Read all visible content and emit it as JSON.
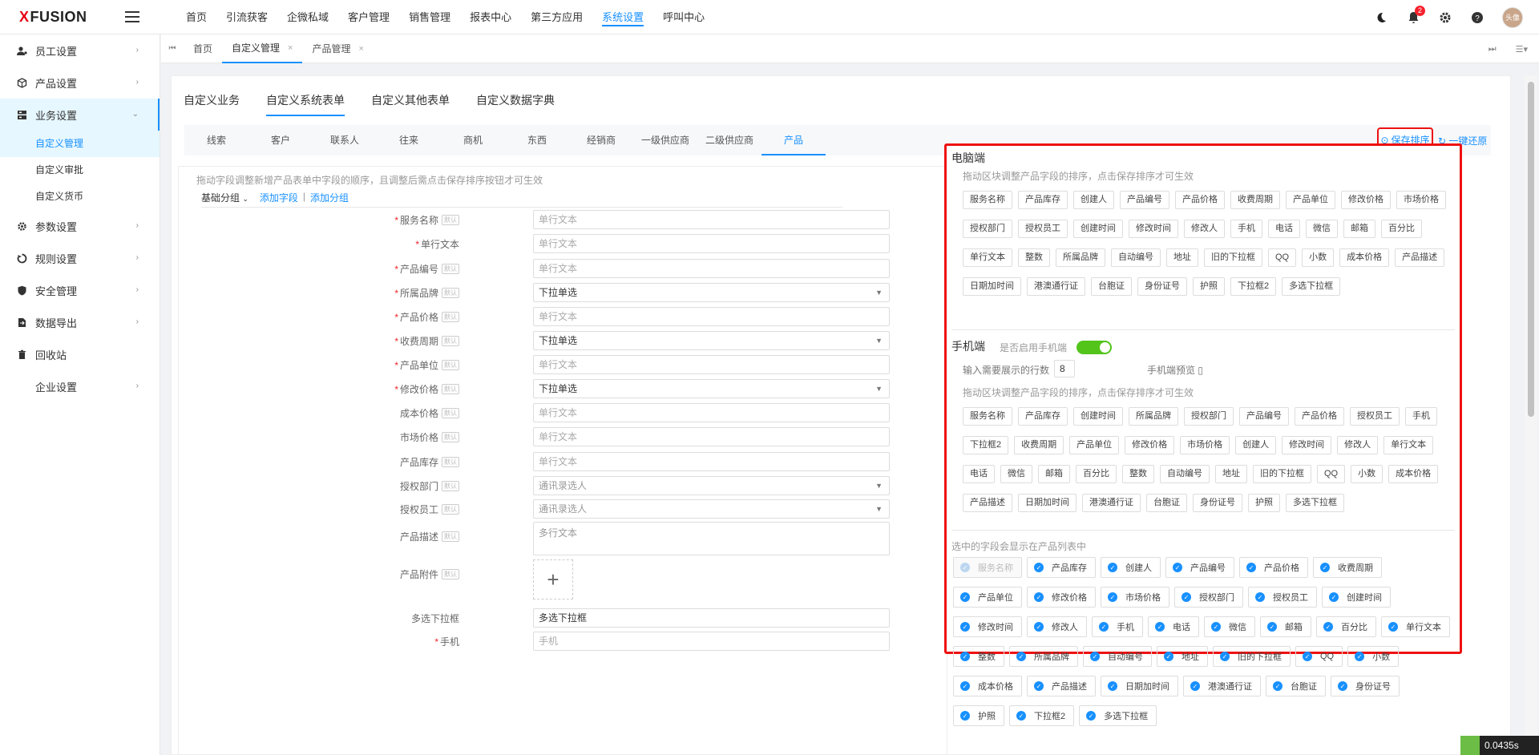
{
  "brand": {
    "prefix": "X",
    "name": "FUSION"
  },
  "topnav": [
    "首页",
    "引流获客",
    "企微私域",
    "客户管理",
    "销售管理",
    "报表中心",
    "第三方应用",
    "系统设置",
    "呼叫中心"
  ],
  "topnav_active": 7,
  "notif_count": "2",
  "avatar_text": "头像",
  "sidebar": [
    {
      "label": "员工设置",
      "icon": "user-gear-icon"
    },
    {
      "label": "产品设置",
      "icon": "box-icon"
    },
    {
      "label": "业务设置",
      "icon": "business-icon",
      "open": true,
      "children": [
        "自定义管理",
        "自定义审批",
        "自定义货币"
      ]
    },
    {
      "label": "参数设置",
      "icon": "settings-icon"
    },
    {
      "label": "规则设置",
      "icon": "rule-icon"
    },
    {
      "label": "安全管理",
      "icon": "shield-icon"
    },
    {
      "label": "数据导出",
      "icon": "export-icon"
    },
    {
      "label": "回收站",
      "icon": "trash-icon"
    },
    {
      "label": "企业设置",
      "icon": ""
    }
  ],
  "tabs": [
    "首页",
    "自定义管理",
    "产品管理"
  ],
  "tab_active": 1,
  "main_tabs": [
    "自定义业务",
    "自定义系统表单",
    "自定义其他表单",
    "自定义数据字典"
  ],
  "main_tab_active": 1,
  "sub_tabs": [
    "线索",
    "客户",
    "联系人",
    "往来",
    "商机",
    "东西",
    "经销商",
    "一级供应商",
    "二级供应商",
    "产品"
  ],
  "sub_tab_active": 9,
  "buttons": {
    "save": "保存排序",
    "restore": "一键还原"
  },
  "form": {
    "hint": "拖动字段调整新增产品表单中字段的顺序，且调整后需点击保存排序按钮才可生效",
    "group_select": "基础分组",
    "add_field": "添加字段",
    "add_group": "添加分组",
    "fields": [
      {
        "label": "服务名称",
        "req": true,
        "tag": "默认",
        "type": "text",
        "ph": "单行文本"
      },
      {
        "label": "单行文本",
        "req": true,
        "tag": "",
        "type": "text",
        "ph": "单行文本"
      },
      {
        "label": "产品编号",
        "req": true,
        "tag": "默认",
        "type": "text",
        "ph": "单行文本"
      },
      {
        "label": "所属品牌",
        "req": true,
        "tag": "默认",
        "type": "select",
        "ph": "下拉单选"
      },
      {
        "label": "产品价格",
        "req": true,
        "tag": "默认",
        "type": "text",
        "ph": "单行文本"
      },
      {
        "label": "收费周期",
        "req": true,
        "tag": "默认",
        "type": "select",
        "ph": "下拉单选"
      },
      {
        "label": "产品单位",
        "req": true,
        "tag": "默认",
        "type": "text",
        "ph": "单行文本"
      },
      {
        "label": "修改价格",
        "req": true,
        "tag": "默认",
        "type": "select",
        "ph": "下拉单选"
      },
      {
        "label": "成本价格",
        "req": false,
        "tag": "默认",
        "type": "text",
        "ph": "单行文本"
      },
      {
        "label": "市场价格",
        "req": false,
        "tag": "默认",
        "type": "text",
        "ph": "单行文本"
      },
      {
        "label": "产品库存",
        "req": false,
        "tag": "默认",
        "type": "text",
        "ph": "单行文本"
      },
      {
        "label": "授权部门",
        "req": false,
        "tag": "默认",
        "type": "select-light",
        "ph": "通讯录选人"
      },
      {
        "label": "授权员工",
        "req": false,
        "tag": "默认",
        "type": "select-light",
        "ph": "通讯录选人"
      },
      {
        "label": "产品描述",
        "req": false,
        "tag": "默认",
        "type": "textarea",
        "ph": "多行文本"
      },
      {
        "label": "产品附件",
        "req": false,
        "tag": "默认",
        "type": "upload",
        "ph": "+"
      },
      {
        "label": "多选下拉框",
        "req": false,
        "tag": "",
        "type": "text-dark",
        "ph": "多选下拉框"
      },
      {
        "label": "手机",
        "req": true,
        "tag": "",
        "type": "text",
        "ph": "手机"
      }
    ]
  },
  "pc": {
    "title": "电脑端",
    "hint": "拖动区块调整产品字段的排序，点击保存排序才可生效",
    "chips": [
      "服务名称",
      "产品库存",
      "创建人",
      "产品编号",
      "产品价格",
      "收费周期",
      "产品单位",
      "修改价格",
      "市场价格",
      "授权部门",
      "授权员工",
      "创建时间",
      "修改时间",
      "修改人",
      "手机",
      "电话",
      "微信",
      "邮箱",
      "百分比",
      "单行文本",
      "整数",
      "所属品牌",
      "自动编号",
      "地址",
      "旧的下拉框",
      "QQ",
      "小数",
      "成本价格",
      "产品描述",
      "日期加时间",
      "港澳通行证",
      "台胞证",
      "身份证号",
      "护照",
      "下拉框2",
      "多选下拉框"
    ]
  },
  "mobile": {
    "title": "手机端",
    "toggle_label": "是否启用手机端",
    "rows_label": "输入需要展示的行数",
    "rows_value": "8",
    "preview": "手机端预览",
    "hint": "拖动区块调整产品字段的排序，点击保存排序才可生效",
    "chips": [
      "服务名称",
      "产品库存",
      "创建时间",
      "所属品牌",
      "授权部门",
      "产品编号",
      "产品价格",
      "授权员工",
      "手机",
      "下拉框2",
      "收费周期",
      "产品单位",
      "修改价格",
      "市场价格",
      "创建人",
      "修改时间",
      "修改人",
      "单行文本",
      "电话",
      "微信",
      "邮箱",
      "百分比",
      "整数",
      "自动编号",
      "地址",
      "旧的下拉框",
      "QQ",
      "小数",
      "成本价格",
      "产品描述",
      "日期加时间",
      "港澳通行证",
      "台胞证",
      "身份证号",
      "护照",
      "多选下拉框"
    ]
  },
  "list": {
    "hint": "选中的字段会显示在产品列表中",
    "items": [
      "服务名称",
      "产品库存",
      "创建人",
      "产品编号",
      "产品价格",
      "收费周期",
      "产品单位",
      "修改价格",
      "市场价格",
      "授权部门",
      "授权员工",
      "创建时间",
      "修改时间",
      "修改人",
      "手机",
      "电话",
      "微信",
      "邮箱",
      "百分比",
      "单行文本",
      "整数",
      "所属品牌",
      "自动编号",
      "地址",
      "旧的下拉框",
      "QQ",
      "小数",
      "成本价格",
      "产品描述",
      "日期加时间",
      "港澳通行证",
      "台胞证",
      "身份证号",
      "护照",
      "下拉框2",
      "多选下拉框"
    ],
    "disabled_index": 0
  },
  "timer": "0.0435s",
  "colors": {
    "accent": "#1890ff",
    "highlight": "#ee1111",
    "toggle": "#52c41a"
  }
}
